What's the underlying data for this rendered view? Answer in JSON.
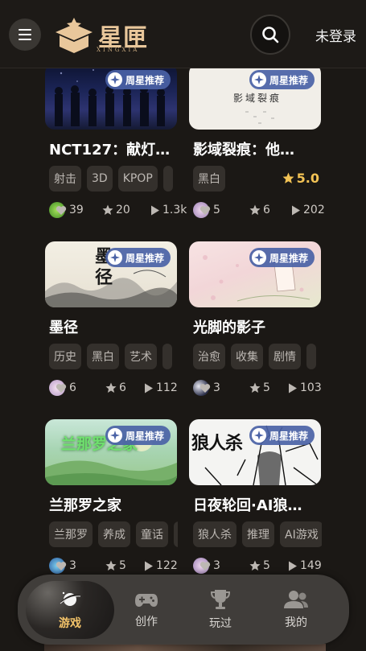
{
  "header": {
    "logo_text": "星匣",
    "logo_sub": "XINGXIA",
    "login_label": "未登录",
    "icons": [
      "menu-icon",
      "search-icon"
    ]
  },
  "badge_label": "周星推荐",
  "cards": [
    {
      "title": "NCT127：献灯…",
      "tags": [
        "射击",
        "3D",
        "KPOP",
        ""
      ],
      "likes": "39",
      "stars": "20",
      "plays": "1.3k",
      "rating": ""
    },
    {
      "title": "影域裂痕：他…",
      "tags": [
        "黑白"
      ],
      "likes": "5",
      "stars": "6",
      "plays": "202",
      "rating": "5.0",
      "thumb_text": "影域裂痕"
    },
    {
      "title": "墨径",
      "tags": [
        "历史",
        "黑白",
        "艺术",
        ""
      ],
      "likes": "6",
      "stars": "6",
      "plays": "112",
      "rating": "",
      "thumb_text": "墨径"
    },
    {
      "title": "光脚的影子",
      "tags": [
        "治愈",
        "收集",
        "剧情",
        ""
      ],
      "likes": "3",
      "stars": "5",
      "plays": "103",
      "rating": ""
    },
    {
      "title": "兰那罗之家",
      "tags": [
        "兰那罗",
        "养成",
        "童话",
        ""
      ],
      "likes": "3",
      "stars": "5",
      "plays": "122",
      "rating": "",
      "thumb_text": "兰那罗之家"
    },
    {
      "title": "日夜轮回·AI狼…",
      "tags": [
        "狼人杀",
        "推理",
        "AI游戏"
      ],
      "likes": "3",
      "stars": "5",
      "plays": "149",
      "rating": "",
      "thumb_text": "狼人杀"
    }
  ],
  "nav": {
    "items": [
      {
        "label": "游戏",
        "icon": "game-planet-icon",
        "active": true
      },
      {
        "label": "创作",
        "icon": "gamepad-icon",
        "active": false
      },
      {
        "label": "玩过",
        "icon": "trophy-icon",
        "active": false
      },
      {
        "label": "我的",
        "icon": "user-group-icon",
        "active": false
      }
    ]
  },
  "colors": {
    "background": "#1b1815",
    "accent": "#f4c46a",
    "badge": "#4a62a6",
    "rating": "#f3c355"
  }
}
